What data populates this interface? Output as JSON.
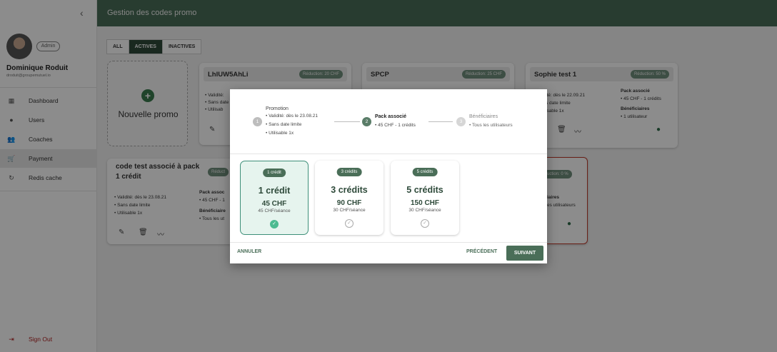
{
  "sidebar": {
    "collapse_icon": "chevron-left-icon",
    "admin_badge": "Admin",
    "user_name": "Dominique Roduit",
    "user_email": "droduit@groupemutuel.io",
    "items": [
      {
        "label": "Dashboard",
        "icon": "dashboard-icon",
        "glyph": "▦"
      },
      {
        "label": "Users",
        "icon": "user-icon",
        "glyph": "●"
      },
      {
        "label": "Coaches",
        "icon": "coaches-icon",
        "glyph": "👥"
      },
      {
        "label": "Payment",
        "icon": "cart-icon",
        "glyph": "🛒"
      },
      {
        "label": "Redis cache",
        "icon": "refresh-icon",
        "glyph": "↻"
      }
    ],
    "signout": {
      "label": "Sign Out",
      "glyph": "⇥"
    }
  },
  "header": {
    "title": "Gestion des codes promo"
  },
  "filters": {
    "all": "ALL",
    "actives": "ACTIVES",
    "inactives": "INACTIVES"
  },
  "new_promo": {
    "label": "Nouvelle promo",
    "plus": "+"
  },
  "promos": [
    {
      "title": "LhIUW5AhLi",
      "badge": "Réduction: 20 CHF",
      "lines": [
        "• Validité:",
        "• Sans date",
        "• Utilisab"
      ]
    },
    {
      "title": "SPCP",
      "badge": "Réduction: 25 CHF"
    },
    {
      "title": "Sophie test 1",
      "badge": "Réduction: 50 %",
      "lines": [
        "ité: dès le 22.09.21",
        "s date limite",
        "isable 1x"
      ],
      "right_title": "Pack associé",
      "right_line": "• 45 CHF - 1 crédits",
      "right_title2": "Bénéficiaires",
      "right_line2": "• 1 utilisateur"
    },
    {
      "title_l1": "code test associé à pack",
      "title_l2": "1 crédit",
      "badge": "Réduct",
      "lines": [
        "• Validité: dès le 23.08.21",
        "• Sans date limite",
        "• Utilisable 1x"
      ],
      "right_title": "Pack assoc",
      "right_line": "• 45 CHF - 1",
      "right_title2": "Bénéficiaire",
      "right_line2": "• Tous les ut"
    },
    {
      "badge": "uction: 0 %",
      "right_title": "iaires",
      "right_line": "es utilisateurs"
    }
  ],
  "modal": {
    "steps": [
      {
        "num": "1",
        "title": "Promotion",
        "lines": [
          "• Validité: dès le 23.08.21",
          "• Sans date limite",
          "• Utilisable 1x"
        ]
      },
      {
        "num": "2",
        "title": "Pack associé",
        "lines": [
          "• 45 CHF - 1 crédits"
        ]
      },
      {
        "num": "3",
        "title": "Bénéficiaires",
        "lines": [
          "• Tous les utilisateurs"
        ]
      }
    ],
    "packs": [
      {
        "badge": "1 crédit",
        "title": "1 crédit",
        "price": "45 CHF",
        "sub": "45 CHF/séance",
        "selected": true
      },
      {
        "badge": "3 crédits",
        "title": "3 crédits",
        "price": "90 CHF",
        "sub": "30 CHF/séance",
        "selected": false
      },
      {
        "badge": "5 crédits",
        "title": "5 crédits",
        "price": "150 CHF",
        "sub": "30 CHF/séance",
        "selected": false
      }
    ],
    "check_glyph": "✓",
    "cancel": "ANNULER",
    "previous": "PRÉCÉDENT",
    "next": "SUIVANT"
  },
  "colors": {
    "brand": "#4a6e58",
    "dark_brand": "#2e4a3a",
    "selected_bg": "#e6f4ee",
    "check": "#4dbb91",
    "signout": "#b02020"
  }
}
